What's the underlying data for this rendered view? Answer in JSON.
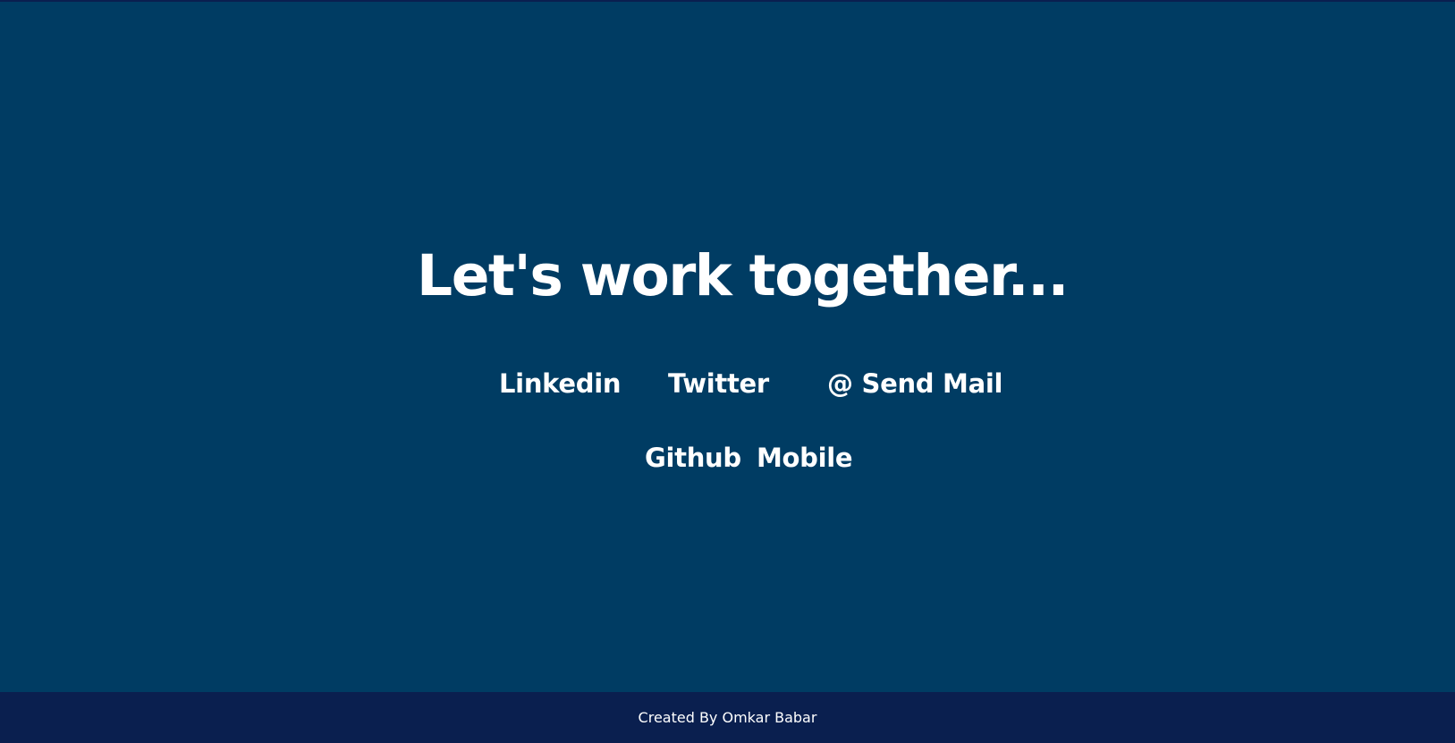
{
  "contact": {
    "headline": "Let's work together...",
    "links": {
      "linkedin": "Linkedin",
      "twitter": "Twitter",
      "mail": "@ Send Mail",
      "github": "Github",
      "mobile": "Mobile"
    }
  },
  "footer": {
    "text": "Created By Omkar Babar"
  },
  "colors": {
    "background": "#003c63",
    "footer_background": "#0a1f4f",
    "text": "#ffffff"
  }
}
